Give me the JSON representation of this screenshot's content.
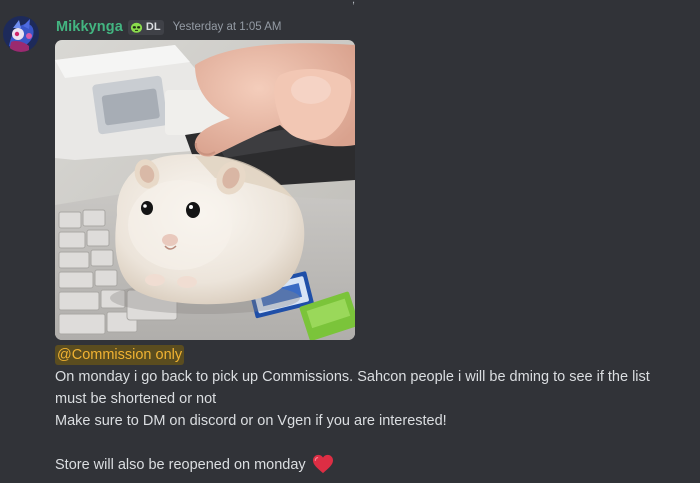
{
  "message": {
    "author": "Mikkynga",
    "server_tag": "DL",
    "timestamp": "Yesterday at 1:05 AM",
    "mention": "@Commission only",
    "lines": [
      "On monday i go back to pick up Commissions. Sahcon people i will be dming to see if the list",
      "must be shortened or not",
      "Make sure to DM on discord or on Vgen if you are interested!"
    ],
    "closing_line": "Store will also be reopened on monday"
  },
  "colors": {
    "background": "#313338",
    "username": "#43b581",
    "mention_text": "#f0b232",
    "mention_bg": "#5b4d1f",
    "body_text": "#dbdee1",
    "timestamp": "#949ba4"
  },
  "icons": {
    "tag_icon": "alien-face-icon",
    "emoji": "red-heart-emoji"
  },
  "attachment": {
    "kind": "gif",
    "subject": "hamster-on-laptop"
  }
}
